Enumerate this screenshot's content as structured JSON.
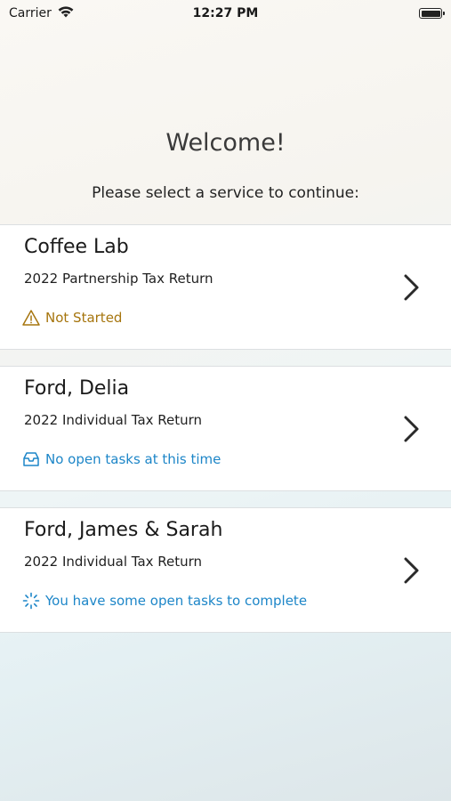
{
  "status_bar": {
    "carrier": "Carrier",
    "time": "12:27 PM"
  },
  "header": {
    "title": "Welcome!",
    "subtitle": "Please select a service to continue:"
  },
  "services": [
    {
      "name": "Coffee Lab",
      "service": "2022 Partnership Tax Return",
      "status": "Not Started",
      "status_icon": "warning-icon",
      "status_color": "#a6750e"
    },
    {
      "name": "Ford, Delia",
      "service": "2022 Individual Tax Return",
      "status": "No open tasks at this time",
      "status_icon": "inbox-icon",
      "status_color": "#1d86c8"
    },
    {
      "name": "Ford, James & Sarah",
      "service": "2022 Individual Tax Return",
      "status": "You have some open tasks to complete",
      "status_icon": "spinner-icon",
      "status_color": "#1d86c8"
    }
  ]
}
